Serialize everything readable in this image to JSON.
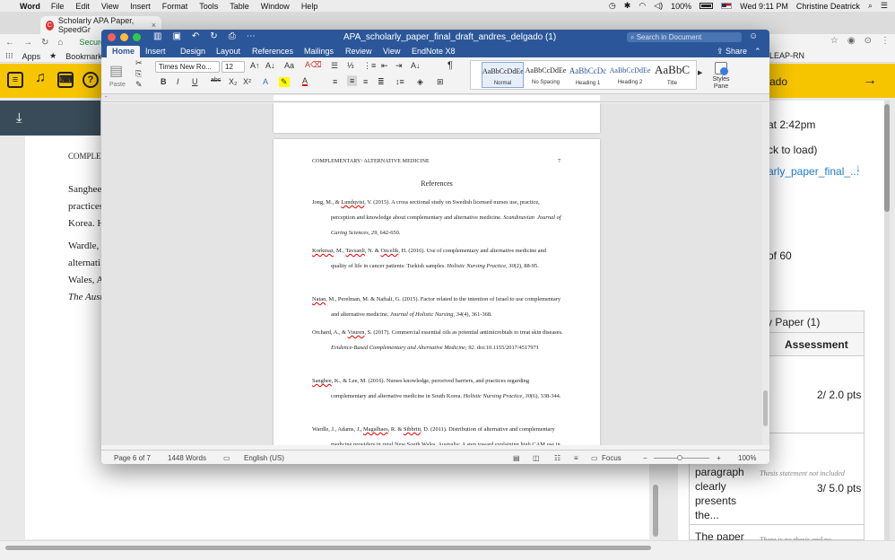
{
  "menubar": {
    "app": "Word",
    "items": [
      "File",
      "Edit",
      "View",
      "Insert",
      "Format",
      "Tools",
      "Table",
      "Window",
      "Help"
    ],
    "battery": "100%",
    "clock": "Wed 9:11 PM",
    "user": "Christine Deatrick"
  },
  "browser": {
    "tab_title": "Scholarly APA Paper, SpeedGr",
    "secure_label": "Secure",
    "bookmarks": [
      "Apps",
      "Bookmarks"
    ],
    "leap": "LEAP-RN"
  },
  "speedgrader": {
    "student_partial": "ado",
    "bg_doc_lines": [
      "COMPLEM",
      "Sanghee",
      "practices",
      "Korea. H",
      "Wardle, ",
      "alternati",
      "Wales, A",
      "The Aust"
    ],
    "submitted_time": "at 2:42pm",
    "click_to_load": "ck to load)",
    "file_link": "arly_paper_final_...",
    "page_count": "of 60",
    "rubric_title": "y Paper (1)",
    "assessment_header": "Assessment",
    "rows": [
      {
        "pts": "2/ 2.0 pts"
      },
      {
        "criterion": [
          "paragraph",
          "clearly",
          "presents",
          "the..."
        ],
        "note": "Thesis statement not included",
        "pts": "3/ 5.0 pts"
      },
      {
        "criterion": [
          "The paper"
        ],
        "note": "There is no thesis and no"
      }
    ]
  },
  "word": {
    "doc_title": "APA_scholarly_paper_final_draft_andres_delgado (1)",
    "search_placeholder": "Search in Document",
    "share": "Share",
    "tabs": [
      "Home",
      "Insert",
      "Design",
      "Layout",
      "References",
      "Mailings",
      "Review",
      "View",
      "EndNote X8"
    ],
    "ribbon": {
      "paste": "Paste",
      "font_name": "Times New Ro...",
      "font_size": "12",
      "styles": [
        {
          "sample": "AaBbCcDdEe",
          "label": "Normal"
        },
        {
          "sample": "AaBbCcDdEe",
          "label": "No Spacing"
        },
        {
          "sample": "AaBbCcDc",
          "label": "Heading 1"
        },
        {
          "sample": "AaBbCcDdEe",
          "label": "Heading 2"
        },
        {
          "sample": "AaBbC",
          "label": "Title"
        }
      ],
      "styles_pane": "Styles Pane"
    },
    "page": {
      "running_head": "COMPLEMENTARY/ ALTERNATIVE MEDICINE",
      "page_number": "7",
      "title": "References"
    },
    "status": {
      "page": "Page 6 of 7",
      "words": "1448 Words",
      "language": "English (US)",
      "focus": "Focus",
      "zoom": "100%"
    }
  }
}
